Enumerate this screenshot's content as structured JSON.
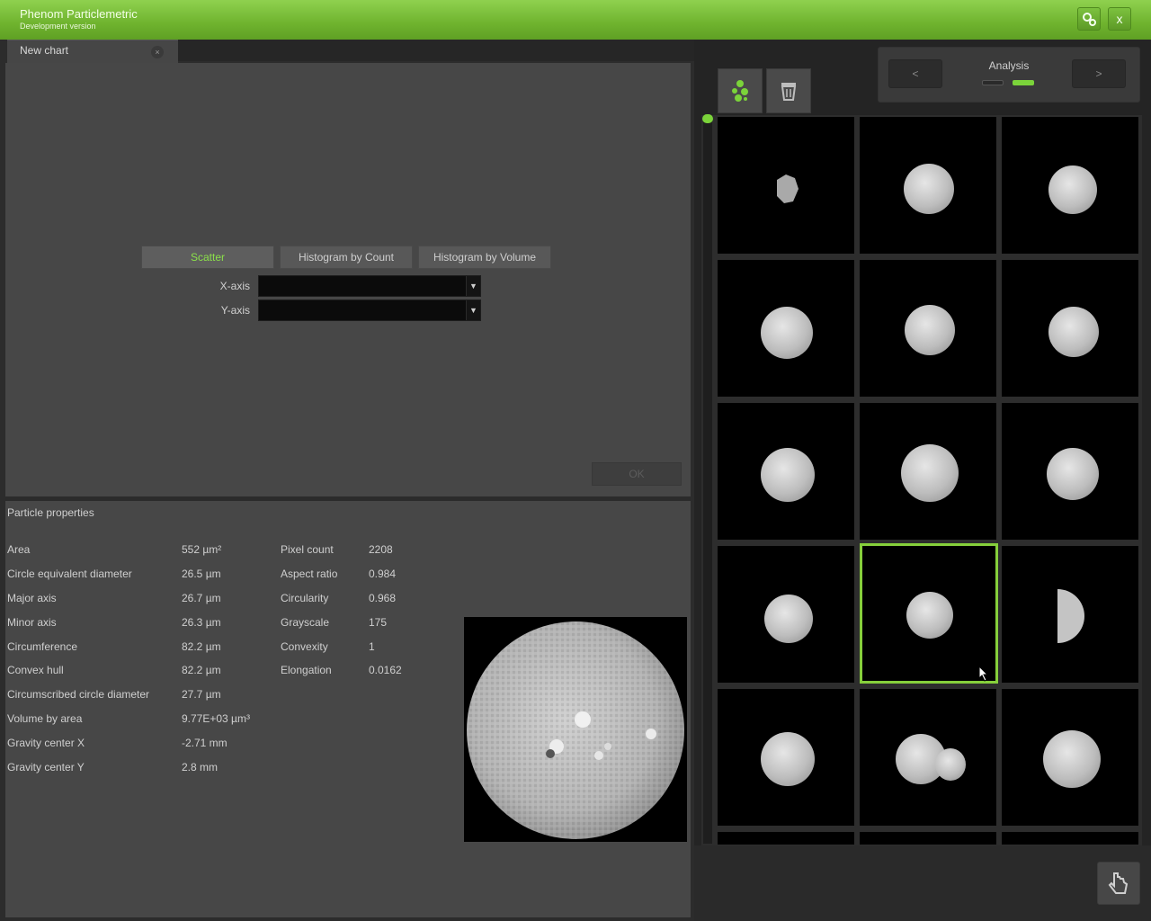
{
  "window": {
    "title": "Phenom Particlemetric",
    "subtitle": "Development version",
    "settings_icon": "gear-icon",
    "close_label": "x",
    "accent_color": "#7cc23f"
  },
  "chart_tab": {
    "label": "New chart",
    "close_label": "×"
  },
  "chart_type": {
    "options": [
      "Scatter",
      "Histogram by Count",
      "Histogram by Volume"
    ],
    "selected": "Scatter"
  },
  "axes": {
    "x_label": "X-axis",
    "y_label": "Y-axis",
    "x_value": "",
    "y_value": ""
  },
  "ok_label": "OK",
  "particle_properties": {
    "title": "Particle properties",
    "left": [
      {
        "name": "Area",
        "value": "552 µm²"
      },
      {
        "name": "Circle equivalent diameter",
        "value": "26.5 µm"
      },
      {
        "name": "Major axis",
        "value": "26.7 µm"
      },
      {
        "name": "Minor axis",
        "value": "26.3 µm"
      },
      {
        "name": "Circumference",
        "value": "82.2 µm"
      },
      {
        "name": "Convex hull",
        "value": "82.2 µm"
      },
      {
        "name": "Circumscribed circle diameter",
        "value": "27.7 µm"
      },
      {
        "name": "Volume by area",
        "value": "9.77E+03 µm³"
      },
      {
        "name": "Gravity center X",
        "value": "-2.71 mm"
      },
      {
        "name": "Gravity center Y",
        "value": "2.8 mm"
      }
    ],
    "right": [
      {
        "name": "Pixel count",
        "value": "2208"
      },
      {
        "name": "Aspect ratio",
        "value": "0.984"
      },
      {
        "name": "Circularity",
        "value": "0.968"
      },
      {
        "name": "Grayscale",
        "value": "175"
      },
      {
        "name": "Convexity",
        "value": "1"
      },
      {
        "name": "Elongation",
        "value": "0.0162"
      }
    ]
  },
  "analysis_nav": {
    "label": "Analysis",
    "prev": "<",
    "next": ">",
    "page_count": 2,
    "current_page": 2
  },
  "toolbar": {
    "particles_icon": "particles-icon",
    "delete_icon": "trash-icon"
  },
  "gallery": {
    "selected_index": 10,
    "thumbnail_count": 15
  },
  "dock": {
    "icon": "hand-pointer-icon"
  }
}
